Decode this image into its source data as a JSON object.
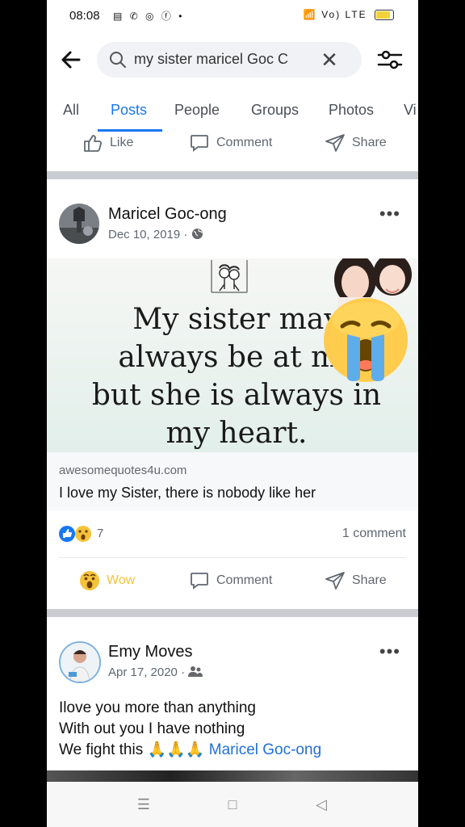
{
  "status_bar": {
    "time": "08:08",
    "right_indicators": "Vo) LTE"
  },
  "search": {
    "query": "my sister maricel Goc C"
  },
  "tabs": [
    {
      "label": "All"
    },
    {
      "label": "Posts"
    },
    {
      "label": "People"
    },
    {
      "label": "Groups"
    },
    {
      "label": "Photos"
    },
    {
      "label": "Vi"
    }
  ],
  "prev_post_actions": {
    "like": "Like",
    "comment": "Comment",
    "share": "Share"
  },
  "post1": {
    "author": "Maricel Goc-ong",
    "date": "Dec 10, 2019",
    "date_sep": "·",
    "quote_lines": [
      "My sister may",
      "always be at my",
      "but she is always in",
      "my heart."
    ],
    "link_domain": "awesomequotes4u.com",
    "link_title": "I love my Sister, there is nobody like her",
    "reaction_count": "7",
    "comment_count": "1 comment",
    "actions": {
      "wow": "Wow",
      "comment": "Comment",
      "share": "Share"
    }
  },
  "post2": {
    "author": "Emy Moves",
    "date": "Apr 17, 2020",
    "date_sep": "·",
    "body_lines": [
      "Ilove  you more than anything",
      "With out you I have nothing",
      "We fight this"
    ],
    "emoji": "🙏🙏🙏",
    "mention": "Maricel Goc-ong"
  },
  "colors": {
    "accent": "#1877f2",
    "wow": "#f5c33b",
    "separator": "#c9ccd1"
  },
  "icons": [
    "back-arrow-icon",
    "search-icon",
    "clear-icon",
    "filter-icon",
    "like-icon",
    "comment-icon",
    "share-icon",
    "globe-icon",
    "friends-icon",
    "more-icon",
    "wow-icon",
    "crying-emoji"
  ]
}
